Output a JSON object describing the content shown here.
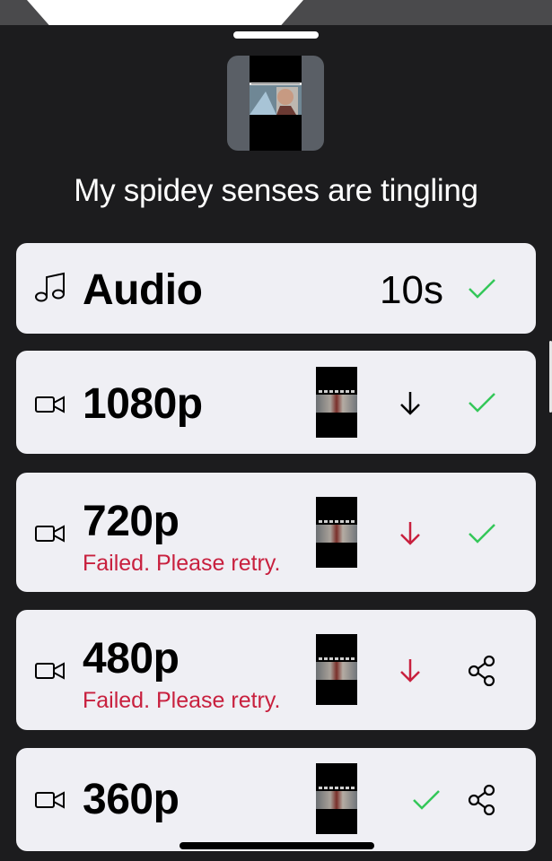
{
  "sheet": {
    "title": "My spidey senses are tingling"
  },
  "colors": {
    "background": "#1c1c1e",
    "row_background": "#efeff4",
    "success": "#34c759",
    "error": "#c8203e"
  },
  "rows": [
    {
      "type_icon": "music-note-icon",
      "label": "Audio",
      "duration": "10s",
      "actions": [
        "checkmark-icon"
      ]
    },
    {
      "type_icon": "video-camera-icon",
      "label": "1080p",
      "actions": [
        "download-arrow-icon",
        "checkmark-icon"
      ]
    },
    {
      "type_icon": "video-camera-icon",
      "label": "720p",
      "error": "Failed. Please retry.",
      "actions": [
        "download-arrow-icon",
        "checkmark-icon"
      ]
    },
    {
      "type_icon": "video-camera-icon",
      "label": "480p",
      "error": "Failed. Please retry.",
      "actions": [
        "download-arrow-icon",
        "share-icon"
      ]
    },
    {
      "type_icon": "video-camera-icon",
      "label": "360p",
      "actions": [
        "checkmark-icon",
        "share-icon"
      ]
    }
  ]
}
